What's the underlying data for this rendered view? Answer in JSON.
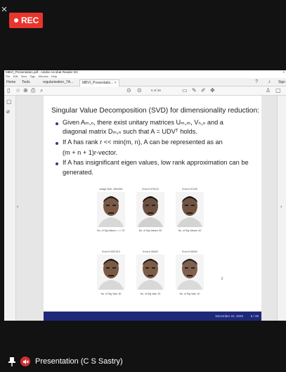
{
  "overlay": {
    "close_symbol": "×",
    "rec_label": "REC"
  },
  "window": {
    "title": "MBVI_Presentation.pdf - Adobe Acrobat Reader DC",
    "menu": [
      "File",
      "Edit",
      "View",
      "Sign",
      "Window",
      "Help"
    ],
    "tabs": [
      {
        "label": "Home"
      },
      {
        "label": "Tools"
      },
      {
        "label": "regularization_7A..."
      },
      {
        "label": "MBVI_Presentatio... ×"
      }
    ],
    "right_tab_label": "Sign",
    "page_indicator": "6 of 28"
  },
  "slide": {
    "title": "Singular Value Decomposition (SVD) for dimensionality reduction:",
    "bullets": [
      [
        "Given Aₘ,ₙ, there exist unitary matrices Uₘ,ₘ, Vₙ,ₙ and a",
        "diagonal matrix Dₘ,ₙ such that A = UDVᵀ holds."
      ],
      [
        "If A has rank r << min(m, n), A can be represented as an",
        "(m + n + 1)r-vector."
      ],
      [
        "If A has insignificant eigen values, low rank approximation can be",
        "generated."
      ]
    ],
    "faces_top_labels": [
      "Image Size: 400x254",
      "Error:0.076124",
      "Error:0.01228"
    ],
    "faces_top_captions": [
      "No. of Sig Values = r = 57",
      "No. of Sig Values: 50",
      "No. of Sig Values: 40"
    ],
    "faces_bottom_labels": [
      "Error:0.0007413",
      "Error:0.06403",
      "Error:0.06040"
    ],
    "faces_bottom_captions": [
      "No. of Sig Vals: 30",
      "No. of Sig Vals: 20",
      "No. of Sig Vals: 10"
    ],
    "footer_date": "December 22, 2020",
    "footer_page": "6 / 28"
  },
  "bottom": {
    "presenter": "Presentation (C S Sastry)"
  },
  "colors": {
    "rec": "#e8352d",
    "footer": "#1f2878",
    "bullet": "#2a3a8a",
    "mute": "#d32f2f"
  },
  "icons": [
    "close-icon",
    "record-dot-icon",
    "pin-icon",
    "mute-icon"
  ]
}
